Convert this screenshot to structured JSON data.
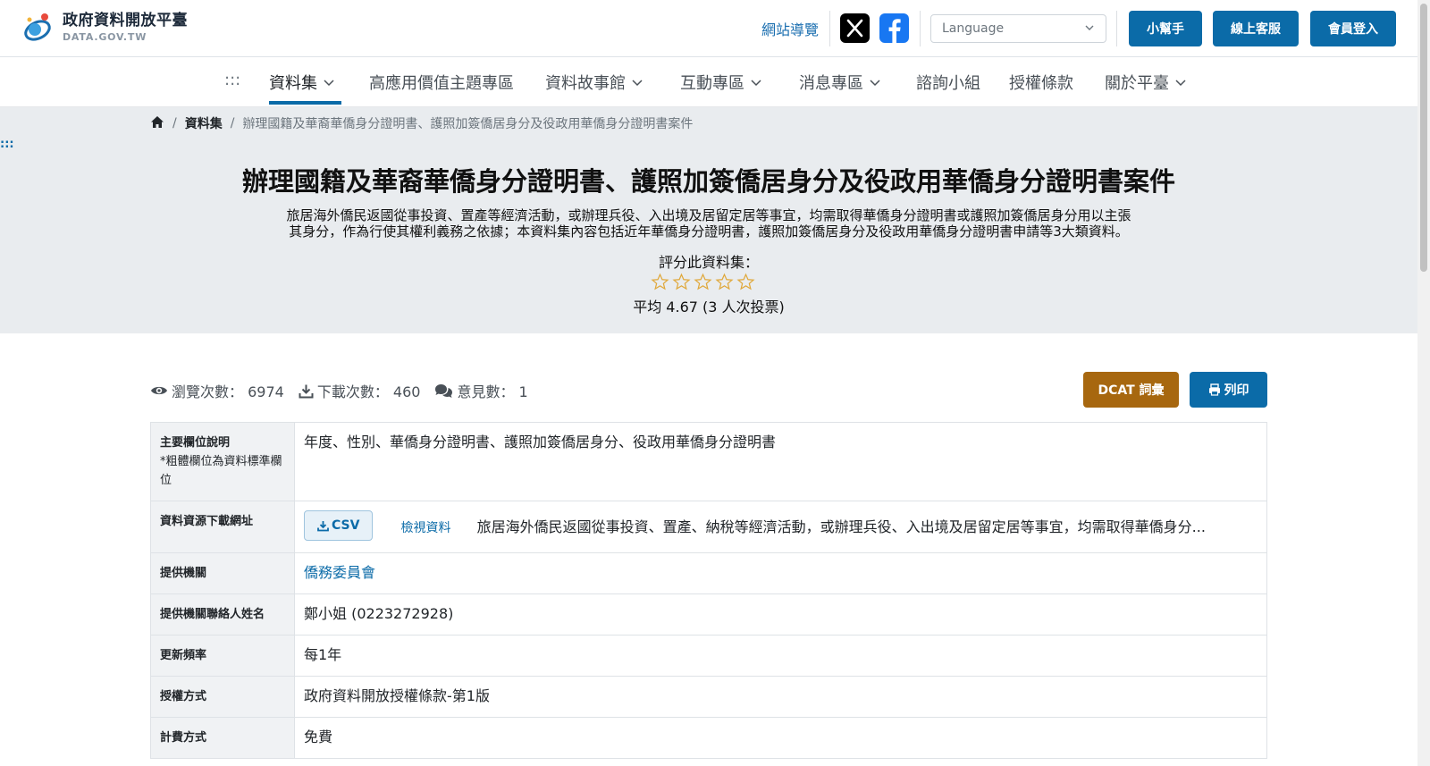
{
  "header": {
    "logo_cn": "政府資料開放平臺",
    "logo_en": "DATA.GOV.TW",
    "sitemap": "網站導覽",
    "language_placeholder": "Language",
    "helper_btn": "小幫手",
    "service_btn": "線上客服",
    "login_btn": "會員登入"
  },
  "nav": {
    "accesskey": ":::",
    "items": [
      "資料集",
      "高應用價值主題專區",
      "資料故事館",
      "互動專區",
      "消息專區",
      "諮詢小組",
      "授權條款",
      "關於平臺"
    ]
  },
  "breadcrumb": {
    "link": "資料集",
    "current": "辦理國籍及華裔華僑身分證明書、護照加簽僑居身分及役政用華僑身分證明書案件"
  },
  "side_accesskey": ":::",
  "hero": {
    "title": "辦理國籍及華裔華僑身分證明書、護照加簽僑居身分及役政用華僑身分證明書案件",
    "desc_line1": "旅居海外僑民返國從事投資、置產等經濟活動，或辦理兵役、入出境及居留定居等事宜，均需取得華僑身分證明書或護照加簽僑居身分用以主張",
    "desc_line2": "其身分，作為行使其權利義務之依據；本資料集內容包括近年華僑身分證明書，護照加簽僑居身分及役政用華僑身分證明書申請等3大類資料。",
    "rate_label": "評分此資料集：",
    "rate_avg": "平均 4.67 (3 人次投票)"
  },
  "stats": {
    "views": "瀏覽次數： 6974",
    "downloads": "下載次數： 460",
    "comments": "意見數： 1"
  },
  "actions": {
    "dcat": "DCAT 詞彙",
    "print": "列印"
  },
  "table": {
    "fields_label": "主要欄位說明",
    "fields_note": "*粗體欄位為資料標準欄位",
    "fields_value": "年度、性別、華僑身分證明書、護照加簽僑居身分、役政用華僑身分證明書",
    "resource_label": "資料資源下載網址",
    "csv": "CSV",
    "view_data": "檢視資料",
    "resource_desc": "旅居海外僑民返國從事投資、置產、納稅等經濟活動，或辦理兵役、入出境及居留定居等事宜，均需取得華僑身分...",
    "org_label": "提供機關",
    "org_value": "僑務委員會",
    "contact_label": "提供機關聯絡人姓名",
    "contact_value": "鄭小姐 (0223272928)",
    "freq_label": "更新頻率",
    "freq_value": "每1年",
    "license_label": "授權方式",
    "license_value": "政府資料開放授權條款-第1版",
    "fee_label": "計費方式",
    "fee_value": "免費"
  },
  "colors": {
    "primary": "#0b6ba8",
    "dcat": "#a7670f",
    "hero_bg": "#e9ecef",
    "star": "#e0a83a"
  }
}
